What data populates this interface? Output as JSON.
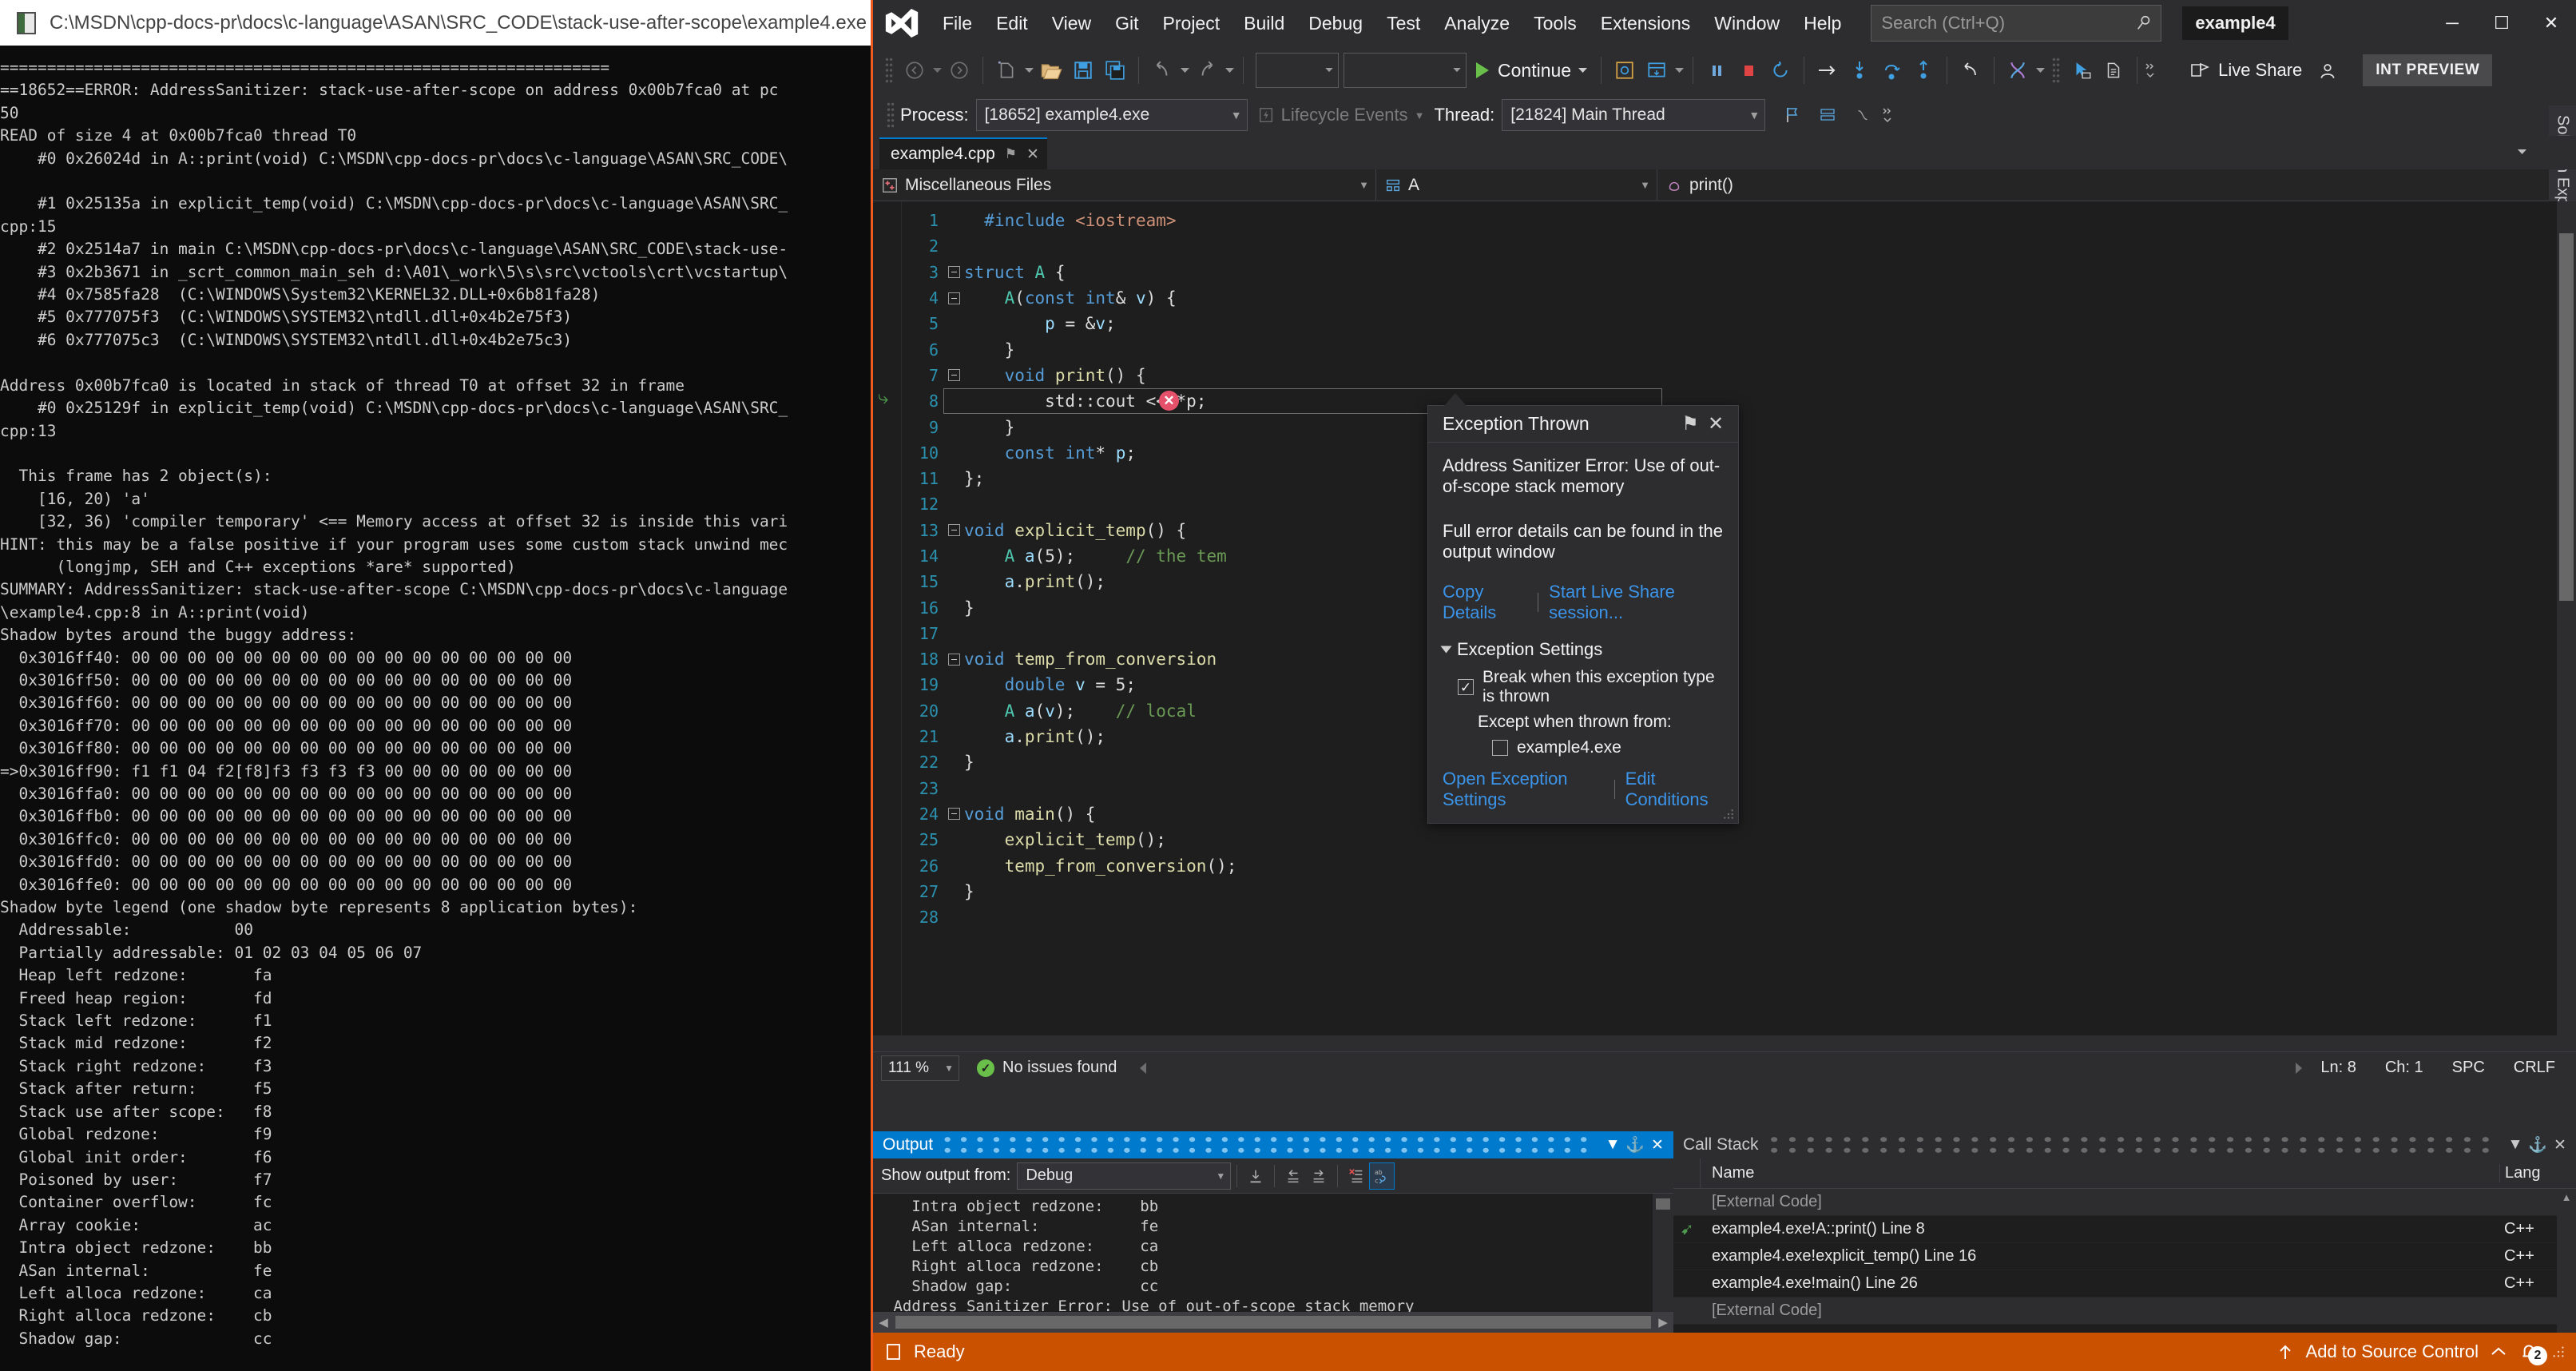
{
  "console": {
    "title": "C:\\MSDN\\cpp-docs-pr\\docs\\c-language\\ASAN\\SRC_CODE\\stack-use-after-scope\\example4.exe",
    "text": "=================================================================\n==18652==ERROR: AddressSanitizer: stack-use-after-scope on address 0x00b7fca0 at pc\n50\nREAD of size 4 at 0x00b7fca0 thread T0\n    #0 0x26024d in A::print(void) C:\\MSDN\\cpp-docs-pr\\docs\\c-language\\ASAN\\SRC_CODE\\\n\n    #1 0x25135a in explicit_temp(void) C:\\MSDN\\cpp-docs-pr\\docs\\c-language\\ASAN\\SRC_\ncpp:15\n    #2 0x2514a7 in main C:\\MSDN\\cpp-docs-pr\\docs\\c-language\\ASAN\\SRC_CODE\\stack-use-\n    #3 0x2b3671 in _scrt_common_main_seh d:\\A01\\_work\\5\\s\\src\\vctools\\crt\\vcstartup\\\n    #4 0x7585fa28  (C:\\WINDOWS\\System32\\KERNEL32.DLL+0x6b81fa28)\n    #5 0x777075f3  (C:\\WINDOWS\\SYSTEM32\\ntdll.dll+0x4b2e75f3)\n    #6 0x777075c3  (C:\\WINDOWS\\SYSTEM32\\ntdll.dll+0x4b2e75c3)\n\nAddress 0x00b7fca0 is located in stack of thread T0 at offset 32 in frame\n    #0 0x25129f in explicit_temp(void) C:\\MSDN\\cpp-docs-pr\\docs\\c-language\\ASAN\\SRC_\ncpp:13\n\n  This frame has 2 object(s):\n    [16, 20) 'a'\n    [32, 36) 'compiler temporary' <== Memory access at offset 32 is inside this vari\nHINT: this may be a false positive if your program uses some custom stack unwind mec\n      (longjmp, SEH and C++ exceptions *are* supported)\nSUMMARY: AddressSanitizer: stack-use-after-scope C:\\MSDN\\cpp-docs-pr\\docs\\c-language\n\\example4.cpp:8 in A::print(void)\nShadow bytes around the buggy address:\n  0x3016ff40: 00 00 00 00 00 00 00 00 00 00 00 00 00 00 00 00\n  0x3016ff50: 00 00 00 00 00 00 00 00 00 00 00 00 00 00 00 00\n  0x3016ff60: 00 00 00 00 00 00 00 00 00 00 00 00 00 00 00 00\n  0x3016ff70: 00 00 00 00 00 00 00 00 00 00 00 00 00 00 00 00\n  0x3016ff80: 00 00 00 00 00 00 00 00 00 00 00 00 00 00 00 00\n=>0x3016ff90: f1 f1 04 f2[f8]f3 f3 f3 f3 00 00 00 00 00 00 00\n  0x3016ffa0: 00 00 00 00 00 00 00 00 00 00 00 00 00 00 00 00\n  0x3016ffb0: 00 00 00 00 00 00 00 00 00 00 00 00 00 00 00 00\n  0x3016ffc0: 00 00 00 00 00 00 00 00 00 00 00 00 00 00 00 00\n  0x3016ffd0: 00 00 00 00 00 00 00 00 00 00 00 00 00 00 00 00\n  0x3016ffe0: 00 00 00 00 00 00 00 00 00 00 00 00 00 00 00 00\nShadow byte legend (one shadow byte represents 8 application bytes):\n  Addressable:           00\n  Partially addressable: 01 02 03 04 05 06 07\n  Heap left redzone:       fa\n  Freed heap region:       fd\n  Stack left redzone:      f1\n  Stack mid redzone:       f2\n  Stack right redzone:     f3\n  Stack after return:      f5\n  Stack use after scope:   f8\n  Global redzone:          f9\n  Global init order:       f6\n  Poisoned by user:        f7\n  Container overflow:      fc\n  Array cookie:            ac\n  Intra object redzone:    bb\n  ASan internal:           fe\n  Left alloca redzone:     ca\n  Right alloca redzone:    cb\n  Shadow gap:              cc"
  },
  "vs": {
    "menu": [
      "File",
      "Edit",
      "View",
      "Git",
      "Project",
      "Build",
      "Debug",
      "Test",
      "Analyze",
      "Tools",
      "Extensions",
      "Window",
      "Help"
    ],
    "search_placeholder": "Search (Ctrl+Q)",
    "project_badge": "example4",
    "window_controls": {
      "minimize": "─",
      "maximize": "☐",
      "close": "✕"
    },
    "toolbar": {
      "continue_label": "Continue",
      "live_share_label": "Live Share",
      "int_preview_label": "INT PREVIEW"
    },
    "debugbar": {
      "process_label": "Process:",
      "process_value": "[18652] example4.exe",
      "lifecycle_label": "Lifecycle Events",
      "thread_label": "Thread:",
      "thread_value": "[21824] Main Thread"
    },
    "tab": {
      "name": "example4.cpp",
      "pin": "⚑",
      "close": "✕"
    },
    "navbar": {
      "project": "Miscellaneous Files",
      "type": "A",
      "member": "print()"
    },
    "right_dock": [
      "Solution Explorer",
      "Team Explorer"
    ],
    "editor_status": {
      "zoom": "111 %",
      "issues": "No issues found",
      "line": "Ln: 8",
      "char": "Ch: 1",
      "spaces": "SPC",
      "eol": "CRLF"
    },
    "statusbar": {
      "status": "Ready",
      "source_control": "Add to Source Control",
      "notification_count": "2"
    }
  },
  "code": {
    "lines": [
      {
        "n": "1",
        "fold": false,
        "indent": 0,
        "tokens": [
          {
            "t": "w",
            "v": "  "
          },
          {
            "t": "k",
            "v": "#include"
          },
          {
            "t": "w",
            "v": " "
          },
          {
            "t": "s",
            "v": "<iostream>"
          }
        ]
      },
      {
        "n": "2",
        "fold": false,
        "indent": 0,
        "tokens": []
      },
      {
        "n": "3",
        "fold": true,
        "indent": 0,
        "tokens": [
          {
            "t": "k",
            "v": "struct"
          },
          {
            "t": "w",
            "v": " "
          },
          {
            "t": "t",
            "v": "A"
          },
          {
            "t": "w",
            "v": " {"
          }
        ]
      },
      {
        "n": "4",
        "fold": true,
        "indent": 1,
        "tokens": [
          {
            "t": "w",
            "v": "    "
          },
          {
            "t": "t",
            "v": "A"
          },
          {
            "t": "w",
            "v": "("
          },
          {
            "t": "k",
            "v": "const"
          },
          {
            "t": "w",
            "v": " "
          },
          {
            "t": "k",
            "v": "int"
          },
          {
            "t": "w",
            "v": "& "
          },
          {
            "t": "p",
            "v": "v"
          },
          {
            "t": "w",
            "v": ") {"
          }
        ]
      },
      {
        "n": "5",
        "fold": false,
        "indent": 2,
        "tokens": [
          {
            "t": "w",
            "v": "        "
          },
          {
            "t": "p",
            "v": "p"
          },
          {
            "t": "w",
            "v": " = &"
          },
          {
            "t": "p",
            "v": "v"
          },
          {
            "t": "w",
            "v": ";"
          }
        ]
      },
      {
        "n": "6",
        "fold": false,
        "indent": 2,
        "tokens": [
          {
            "t": "w",
            "v": "    }"
          }
        ]
      },
      {
        "n": "7",
        "fold": true,
        "indent": 1,
        "tokens": [
          {
            "t": "w",
            "v": "    "
          },
          {
            "t": "k",
            "v": "void"
          },
          {
            "t": "w",
            "v": " "
          },
          {
            "t": "f",
            "v": "print"
          },
          {
            "t": "w",
            "v": "() {"
          }
        ]
      },
      {
        "n": "8",
        "fold": false,
        "indent": 2,
        "tokens": [
          {
            "t": "w",
            "v": "        std::cout << *p;"
          }
        ]
      },
      {
        "n": "9",
        "fold": false,
        "indent": 2,
        "tokens": [
          {
            "t": "w",
            "v": "    }"
          }
        ]
      },
      {
        "n": "10",
        "fold": false,
        "indent": 1,
        "tokens": [
          {
            "t": "w",
            "v": "    "
          },
          {
            "t": "k",
            "v": "const"
          },
          {
            "t": "w",
            "v": " "
          },
          {
            "t": "k",
            "v": "int"
          },
          {
            "t": "w",
            "v": "* "
          },
          {
            "t": "p",
            "v": "p"
          },
          {
            "t": "w",
            "v": ";"
          }
        ]
      },
      {
        "n": "11",
        "fold": false,
        "indent": 0,
        "tokens": [
          {
            "t": "w",
            "v": "};"
          }
        ]
      },
      {
        "n": "12",
        "fold": false,
        "indent": 0,
        "tokens": []
      },
      {
        "n": "13",
        "fold": true,
        "indent": 0,
        "tokens": [
          {
            "t": "k",
            "v": "void"
          },
          {
            "t": "w",
            "v": " "
          },
          {
            "t": "f",
            "v": "explicit_temp"
          },
          {
            "t": "w",
            "v": "() {"
          }
        ]
      },
      {
        "n": "14",
        "fold": false,
        "indent": 1,
        "tokens": [
          {
            "t": "w",
            "v": "    "
          },
          {
            "t": "t",
            "v": "A"
          },
          {
            "t": "w",
            "v": " "
          },
          {
            "t": "p",
            "v": "a"
          },
          {
            "t": "w",
            "v": "(5);     "
          },
          {
            "t": "c",
            "v": "// the tem"
          }
        ]
      },
      {
        "n": "15",
        "fold": false,
        "indent": 1,
        "tokens": [
          {
            "t": "w",
            "v": "    "
          },
          {
            "t": "p",
            "v": "a"
          },
          {
            "t": "w",
            "v": "."
          },
          {
            "t": "f",
            "v": "print"
          },
          {
            "t": "w",
            "v": "();"
          }
        ]
      },
      {
        "n": "16",
        "fold": false,
        "indent": 1,
        "tokens": [
          {
            "t": "w",
            "v": "}"
          }
        ]
      },
      {
        "n": "17",
        "fold": false,
        "indent": 0,
        "tokens": []
      },
      {
        "n": "18",
        "fold": true,
        "indent": 0,
        "tokens": [
          {
            "t": "k",
            "v": "void"
          },
          {
            "t": "w",
            "v": " "
          },
          {
            "t": "f",
            "v": "temp_from_conversion"
          },
          {
            "t": "w",
            "v": ""
          }
        ]
      },
      {
        "n": "19",
        "fold": false,
        "indent": 1,
        "tokens": [
          {
            "t": "w",
            "v": "    "
          },
          {
            "t": "k",
            "v": "double"
          },
          {
            "t": "w",
            "v": " "
          },
          {
            "t": "p",
            "v": "v"
          },
          {
            "t": "w",
            "v": " = 5;"
          }
        ]
      },
      {
        "n": "20",
        "fold": false,
        "indent": 1,
        "tokens": [
          {
            "t": "w",
            "v": "    "
          },
          {
            "t": "t",
            "v": "A"
          },
          {
            "t": "w",
            "v": " "
          },
          {
            "t": "p",
            "v": "a"
          },
          {
            "t": "w",
            "v": "("
          },
          {
            "t": "p",
            "v": "v"
          },
          {
            "t": "w",
            "v": ");    "
          },
          {
            "t": "c",
            "v": "// local "
          }
        ]
      },
      {
        "n": "21",
        "fold": false,
        "indent": 1,
        "tokens": [
          {
            "t": "w",
            "v": "    "
          },
          {
            "t": "p",
            "v": "a"
          },
          {
            "t": "w",
            "v": "."
          },
          {
            "t": "f",
            "v": "print"
          },
          {
            "t": "w",
            "v": "();"
          }
        ]
      },
      {
        "n": "22",
        "fold": false,
        "indent": 1,
        "tokens": [
          {
            "t": "w",
            "v": "}"
          }
        ]
      },
      {
        "n": "23",
        "fold": false,
        "indent": 0,
        "tokens": []
      },
      {
        "n": "24",
        "fold": true,
        "indent": 0,
        "tokens": [
          {
            "t": "k",
            "v": "void"
          },
          {
            "t": "w",
            "v": " "
          },
          {
            "t": "f",
            "v": "main"
          },
          {
            "t": "w",
            "v": "() {"
          }
        ]
      },
      {
        "n": "25",
        "fold": false,
        "indent": 1,
        "tokens": [
          {
            "t": "w",
            "v": "    "
          },
          {
            "t": "f",
            "v": "explicit_temp"
          },
          {
            "t": "w",
            "v": "();"
          }
        ]
      },
      {
        "n": "26",
        "fold": false,
        "indent": 1,
        "tokens": [
          {
            "t": "w",
            "v": "    "
          },
          {
            "t": "f",
            "v": "temp_from_conversion"
          },
          {
            "t": "w",
            "v": "();"
          }
        ]
      },
      {
        "n": "27",
        "fold": false,
        "indent": 1,
        "tokens": [
          {
            "t": "w",
            "v": "}"
          }
        ]
      },
      {
        "n": "28",
        "fold": false,
        "indent": 0,
        "tokens": []
      }
    ]
  },
  "exception": {
    "title": "Exception Thrown",
    "pin": "⚑",
    "close": "✕",
    "message": "Address Sanitizer Error: Use of out-of-scope stack memory",
    "sub_message": "Full error details can be found in the output window",
    "link_copy": "Copy Details",
    "link_liveshare": "Start Live Share session...",
    "settings_title": "Exception Settings",
    "break_label": "Break when this exception type is thrown",
    "break_checked": true,
    "except_label": "Except when thrown from:",
    "exe_label": "example4.exe",
    "exe_checked": false,
    "link_open_settings": "Open Exception Settings",
    "link_edit_conditions": "Edit Conditions"
  },
  "output": {
    "title": "Output",
    "show_from_label": "Show output from:",
    "show_from_value": "Debug",
    "text": "   Intra object redzone:    bb\n   ASan internal:           fe\n   Left alloca redzone:     ca\n   Right alloca redzone:    cb\n   Shadow gap:              cc\n Address Sanitizer Error: Use of out-of-scope stack memory"
  },
  "callstack": {
    "title": "Call Stack",
    "columns": {
      "name": "Name",
      "lang": "Lang"
    },
    "rows": [
      {
        "name": "[External Code]",
        "lang": "",
        "current": false,
        "external": true
      },
      {
        "name": "example4.exe!A::print() Line 8",
        "lang": "C++",
        "current": true,
        "external": false
      },
      {
        "name": "example4.exe!explicit_temp() Line 16",
        "lang": "C++",
        "current": false,
        "external": false
      },
      {
        "name": "example4.exe!main() Line 26",
        "lang": "C++",
        "current": false,
        "external": false
      },
      {
        "name": "[External Code]",
        "lang": "",
        "current": false,
        "external": true
      }
    ]
  },
  "colors": {
    "accent_blue": "#007acc",
    "status_orange": "#ca5100",
    "error_red": "#e5516a",
    "ok_green": "#6abf4b",
    "vs_purple": "#68217a"
  }
}
